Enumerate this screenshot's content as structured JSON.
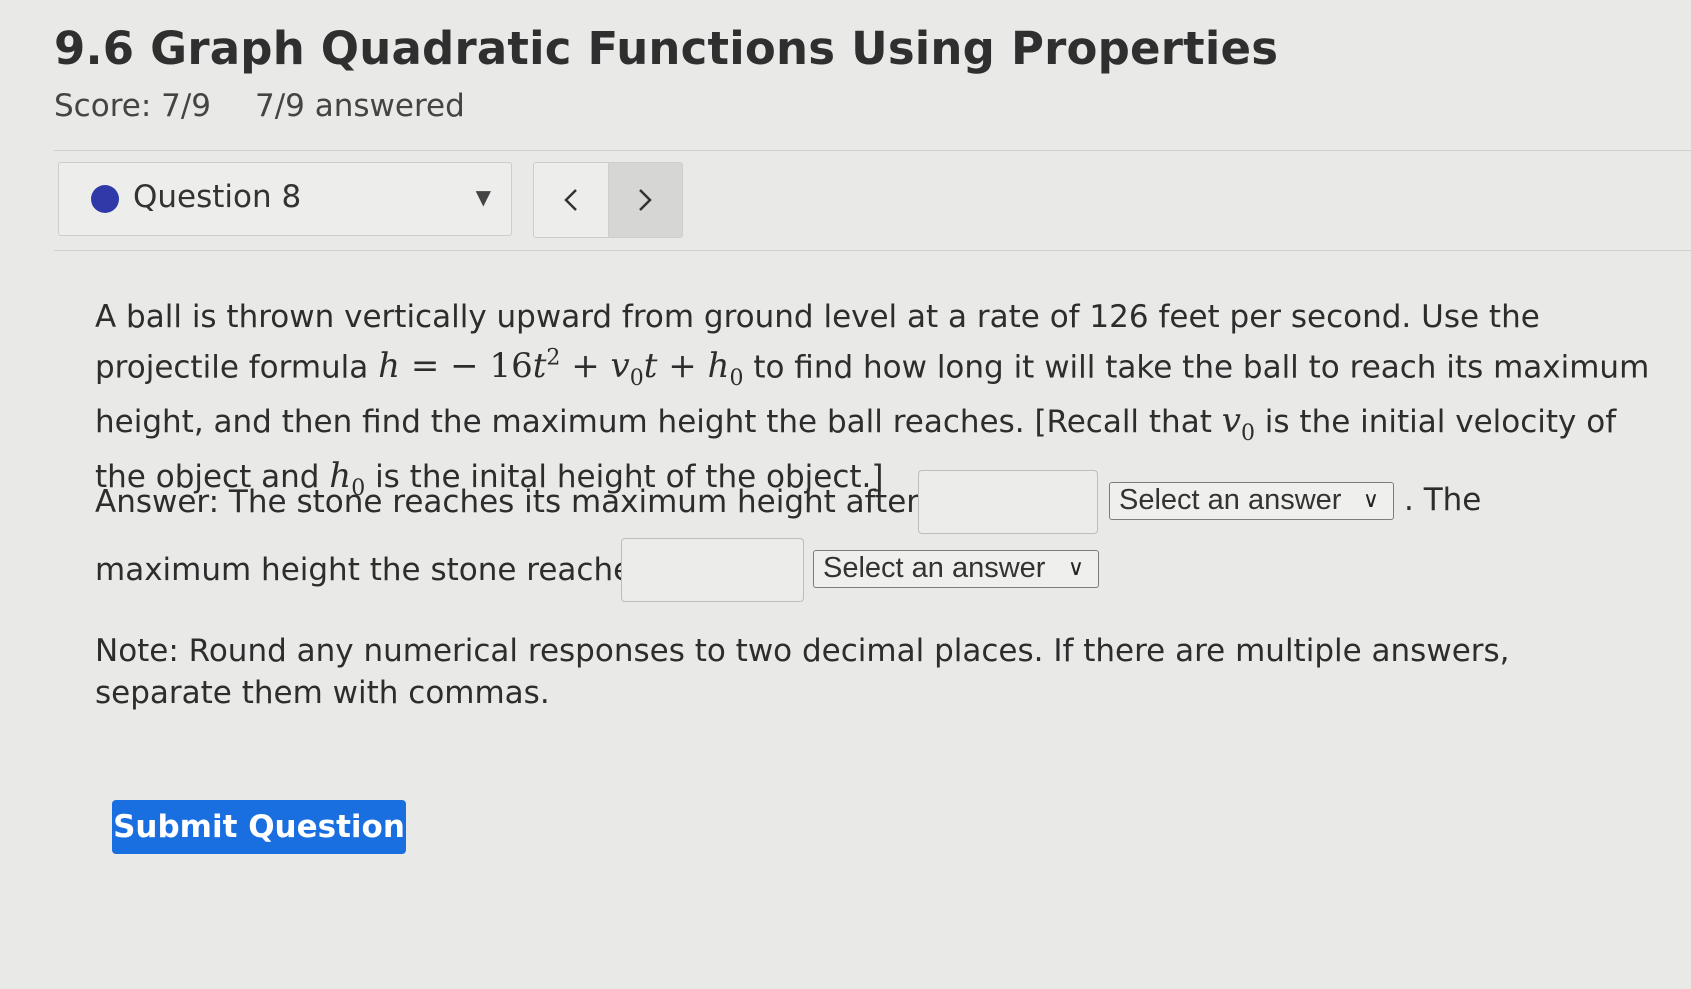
{
  "header": {
    "title": "9.6 Graph Quadratic Functions Using Properties",
    "score": "Score: 7/9",
    "answered": "7/9 answered"
  },
  "question_nav": {
    "label": "Question 8",
    "prev_icon": "chevron-left-icon",
    "next_icon": "chevron-right-icon",
    "status_color": "#2f3aa8"
  },
  "problem": {
    "text_1": "A ball is thrown vertically upward from ground level at a rate of 126 feet per second.  Use the projectile formula",
    "formula_h": "h",
    "formula_eq": "=",
    "formula_minus": "− 16",
    "formula_t": "t",
    "formula_exp": "2",
    "formula_plus1": "+",
    "formula_v": "v",
    "formula_sub0": "0",
    "formula_t2": "t",
    "formula_plus2": "+",
    "formula_h0": "h",
    "formula_h0_sub": "0",
    "text_2": "to find how long it will take the ball to reach its maximum height, and then find the maximum height the ball reaches.  [Recall that",
    "recall_v": "v",
    "recall_v_sub": "0",
    "text_3": "is the initial velocity of the object and",
    "recall_h": "h",
    "recall_h_sub": "0",
    "text_4": "is the inital height of the object.]"
  },
  "answer": {
    "line1_text": "Answer:  The stone reaches its maximum height after after",
    "time_value": "",
    "time_unit_select": "Select an answer",
    "line1_tail": ".  The",
    "line2_text": "maximum height the stone reaches is",
    "height_value": "",
    "height_unit_select": "Select an answer"
  },
  "note": {
    "text": "Note:  Round any numerical responses to two decimal places. If there are multiple answers, separate them with commas."
  },
  "actions": {
    "submit_label": "Submit Question",
    "submit_color": "#1a6fe0"
  }
}
